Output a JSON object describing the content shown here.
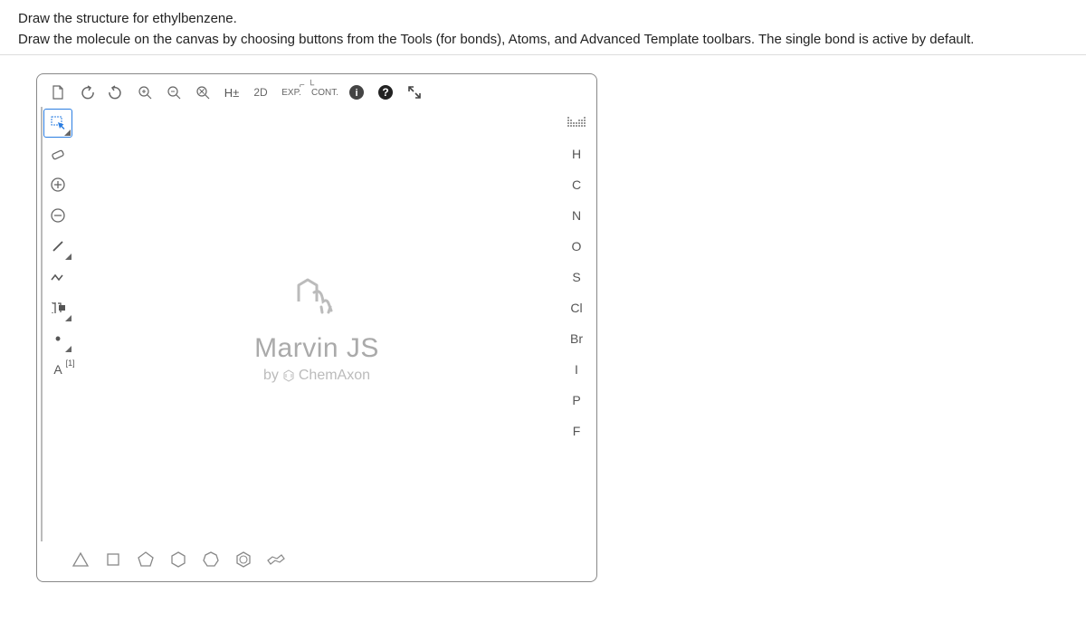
{
  "header": {
    "line1": "Draw the structure for ethylbenzene.",
    "line2": "Draw the molecule on the canvas by choosing buttons from the Tools (for bonds), Atoms, and Advanced Template toolbars. The single bond is active by default."
  },
  "top_toolbar": {
    "hpm": "H±",
    "twod": "2D",
    "exp": "EXP.",
    "cont": "CONT."
  },
  "canvas": {
    "title": "Marvin JS",
    "sub_prefix": "by",
    "sub_brand": "ChemAxon"
  },
  "atoms": [
    "H",
    "C",
    "N",
    "O",
    "S",
    "Cl",
    "Br",
    "I",
    "P",
    "F"
  ],
  "left_tools": {
    "atom_map": "A",
    "atom_map_sup": "[1]"
  }
}
